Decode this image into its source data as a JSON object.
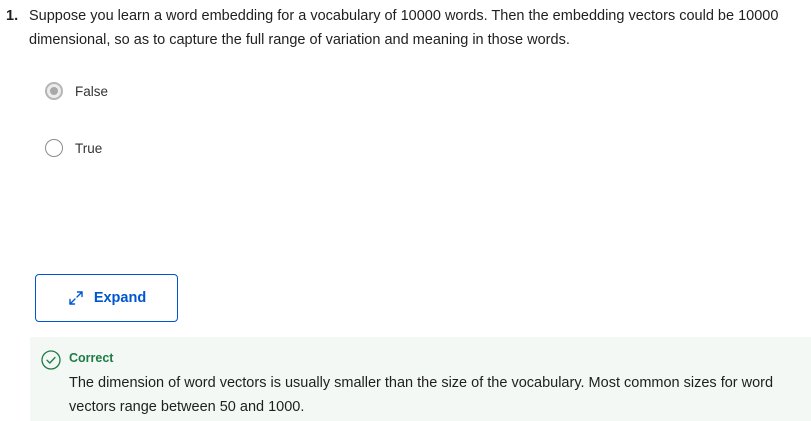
{
  "question": {
    "number": "1.",
    "text": "Suppose you learn a word embedding for a vocabulary of 10000 words. Then the embedding vectors could be 10000 dimensional, so as to capture the full range of variation and meaning in those words."
  },
  "options": [
    {
      "label": "False",
      "selected": true
    },
    {
      "label": "True",
      "selected": false
    }
  ],
  "expand_button": {
    "label": "Expand",
    "icon": "expand-arrows-icon"
  },
  "feedback": {
    "status": "Correct",
    "icon": "check-circle-icon",
    "text": "The dimension of word vectors is usually smaller than the size of the vocabulary. Most common sizes for word vectors range between 50 and 1000.",
    "color": "#1d7b45",
    "background": "#f3f8f5"
  },
  "colors": {
    "accent": "#0056d2",
    "success": "#1d7b45"
  }
}
